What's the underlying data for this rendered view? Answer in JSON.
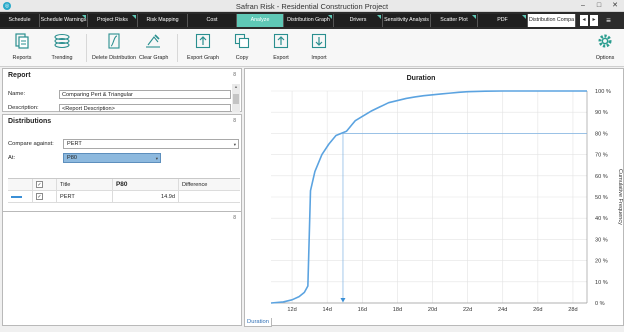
{
  "window": {
    "title": "Safran Risk - Residential Construction Project"
  },
  "tabs": [
    {
      "label": "Schedule",
      "state": "normal"
    },
    {
      "label": "Schedule Warnings",
      "state": "normal"
    },
    {
      "label": "Project Risks",
      "state": "normal"
    },
    {
      "label": "Risk Mapping",
      "state": "normal"
    },
    {
      "label": "Cost",
      "state": "normal"
    },
    {
      "label": "Analyze",
      "state": "active"
    },
    {
      "label": "Distribution Graph",
      "state": "normal"
    },
    {
      "label": "Drivers",
      "state": "normal"
    },
    {
      "label": "Sensitivity Analysis",
      "state": "normal"
    },
    {
      "label": "Scatter Plot",
      "state": "normal"
    },
    {
      "label": "PDF",
      "state": "normal"
    },
    {
      "label": "Distribution Compa",
      "state": "current"
    }
  ],
  "ribbon": {
    "reports": "Reports",
    "trending": "Trending",
    "delete_distribution": "Delete Distribution",
    "clear_graph": "Clear Graph",
    "export_graph": "Export Graph",
    "copy": "Copy",
    "export": "Export",
    "import": "Import",
    "options": "Options"
  },
  "report": {
    "title": "Report",
    "name_label": "Name:",
    "name_value": "Comparing Pert & Triangular",
    "description_label": "Description:",
    "description_value": "<Report Description>"
  },
  "distributions": {
    "title": "Distributions",
    "compare_label": "Compare against:",
    "compare_value": "PERT",
    "at_label": "At:",
    "at_value": "P80",
    "columns": {
      "title": "Title",
      "p80": "P80",
      "difference": "Difference"
    },
    "rows": [
      {
        "title": "PERT",
        "p80": "14.9d",
        "difference": "",
        "color": "#3a8fd6"
      }
    ]
  },
  "pin_glyph": "8",
  "colors": {
    "accent_tab": "#5fc8b6",
    "series": "#5ba3e0",
    "marker": "#3a8fd6"
  },
  "bottom_tab": "Duration",
  "chart_data": {
    "type": "line",
    "title": "Duration",
    "xlabel": "",
    "ylabel": "Cumulative Frequency",
    "x_ticks": [
      "12d",
      "14d",
      "16d",
      "18d",
      "20d",
      "22d",
      "24d",
      "26d",
      "28d"
    ],
    "x_tick_values": [
      12,
      14,
      16,
      18,
      20,
      22,
      24,
      26,
      28
    ],
    "y_ticks": [
      "0 %",
      "10 %",
      "20 %",
      "30 %",
      "40 %",
      "50 %",
      "60 %",
      "70 %",
      "80 %",
      "90 %",
      "100 %"
    ],
    "xlim": [
      10.8,
      28.8
    ],
    "ylim": [
      0,
      100
    ],
    "grid": true,
    "series": [
      {
        "color": "#5ba3e0",
        "x": [
          10.8,
          11.5,
          12.0,
          12.4,
          12.7,
          12.9,
          13.05,
          13.3,
          13.7,
          14.1,
          14.5,
          14.8,
          15.1,
          15.4,
          15.6,
          16.0,
          16.5,
          17.0,
          17.5,
          18.0,
          18.5,
          19.0,
          19.5,
          20.0,
          20.5,
          21.0,
          21.5,
          22.0,
          23.0,
          24.0,
          26.0,
          28.8
        ],
        "y": [
          0,
          0.5,
          1.5,
          3,
          5,
          8,
          53,
          62,
          70,
          75,
          79,
          80,
          81,
          84,
          86,
          88,
          90.5,
          92.5,
          94.5,
          95.5,
          96.5,
          97.2,
          97.8,
          98.2,
          98.6,
          99.0,
          99.4,
          99.7,
          99.9,
          100,
          100,
          100
        ]
      }
    ],
    "marker": {
      "percentile": 80,
      "x": 14.9
    }
  }
}
